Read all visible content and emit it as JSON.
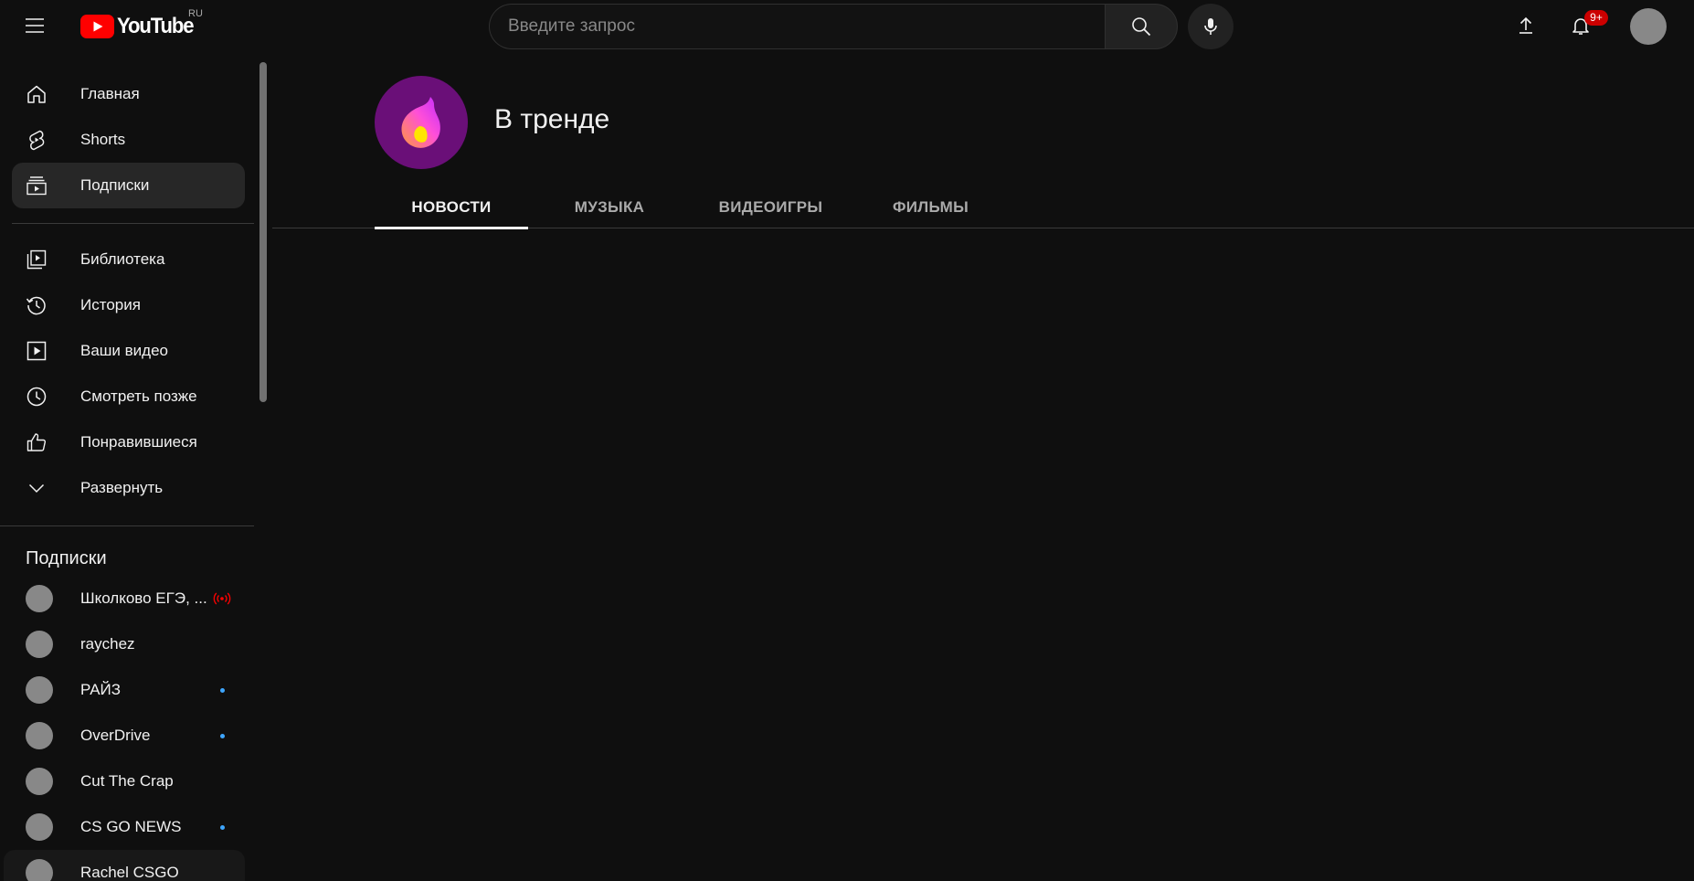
{
  "header": {
    "logo_word": "YouTube",
    "country_code": "RU",
    "search_placeholder": "Введите запрос",
    "notifications_badge": "9+"
  },
  "sidebar": {
    "main_items": [
      {
        "label": "Главная",
        "icon": "home-icon"
      },
      {
        "label": "Shorts",
        "icon": "shorts-icon"
      },
      {
        "label": "Подписки",
        "icon": "subscriptions-icon",
        "active": true
      }
    ],
    "library_items": [
      {
        "label": "Библиотека",
        "icon": "library-icon"
      },
      {
        "label": "История",
        "icon": "history-icon"
      },
      {
        "label": "Ваши видео",
        "icon": "your-videos-icon"
      },
      {
        "label": "Смотреть позже",
        "icon": "watch-later-icon"
      },
      {
        "label": "Понравившиеся",
        "icon": "liked-icon"
      },
      {
        "label": "Развернуть",
        "icon": "chevron-down-icon"
      }
    ],
    "subscriptions_title": "Подписки",
    "subscriptions": [
      {
        "label": "Школково ЕГЭ, ...",
        "indicator": "live"
      },
      {
        "label": "raychez",
        "indicator": "none"
      },
      {
        "label": "РАЙЗ",
        "indicator": "new"
      },
      {
        "label": "OverDrive",
        "indicator": "new"
      },
      {
        "label": "Cut The Crap",
        "indicator": "none"
      },
      {
        "label": "CS GO NEWS",
        "indicator": "new"
      },
      {
        "label": "Rachel CSGO",
        "indicator": "none"
      }
    ]
  },
  "main": {
    "title": "В тренде",
    "tabs": [
      {
        "label": "НОВОСТИ",
        "active": true
      },
      {
        "label": "МУЗЫКА",
        "active": false
      },
      {
        "label": "ВИДЕОИГРЫ",
        "active": false
      },
      {
        "label": "ФИЛЬМЫ",
        "active": false
      }
    ]
  },
  "colors": {
    "background": "#0f0f0f",
    "brand_red": "#ff0000",
    "badge_red": "#cc0000",
    "new_dot_blue": "#3ea6ff",
    "trending_bg": "#6a0f78"
  }
}
